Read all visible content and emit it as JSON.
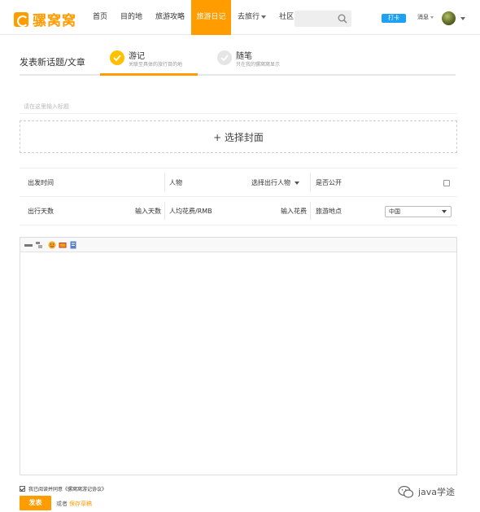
{
  "header": {
    "logo_text": "骡窝窝",
    "nav": [
      {
        "label": "首页"
      },
      {
        "label": "目的地"
      },
      {
        "label": "旅游攻略"
      },
      {
        "label": "旅游日记"
      },
      {
        "label": "去旅行"
      },
      {
        "label": "社区"
      }
    ],
    "active_nav": "旅游日记",
    "search_placeholder": "",
    "checkin_label": "打卡",
    "messages_label": "消息"
  },
  "type_selector": {
    "title": "发表新话题/文章",
    "tabs": [
      {
        "label": "游记",
        "sub": "关联至具体的旅行目的地",
        "active": true
      },
      {
        "label": "随笔",
        "sub": "只在我的骡窝窝显示",
        "active": false
      }
    ]
  },
  "form": {
    "title_placeholder": "请在这里输入标题",
    "cover_label": "+ 选择封面",
    "row1": {
      "depart_label": "出发时间",
      "people_label": "人物",
      "people_select": "选择出行人物",
      "public_label": "是否公开"
    },
    "row2": {
      "days_label": "出行天数",
      "days_placeholder": "输入天数",
      "cost_label": "人均花费/RMB",
      "cost_placeholder": "输入花费",
      "location_label": "旅游地点",
      "location_value": "中国"
    }
  },
  "footer": {
    "agree_text": "我已阅读并同意《骡窝窝游记协议》",
    "publish_label": "发表",
    "or_text": "或者",
    "save_draft_label": "保存草稿"
  },
  "watermark": {
    "text": "java学途"
  },
  "colors": {
    "accent": "#ff9d00",
    "checkin": "#1da1f2"
  }
}
